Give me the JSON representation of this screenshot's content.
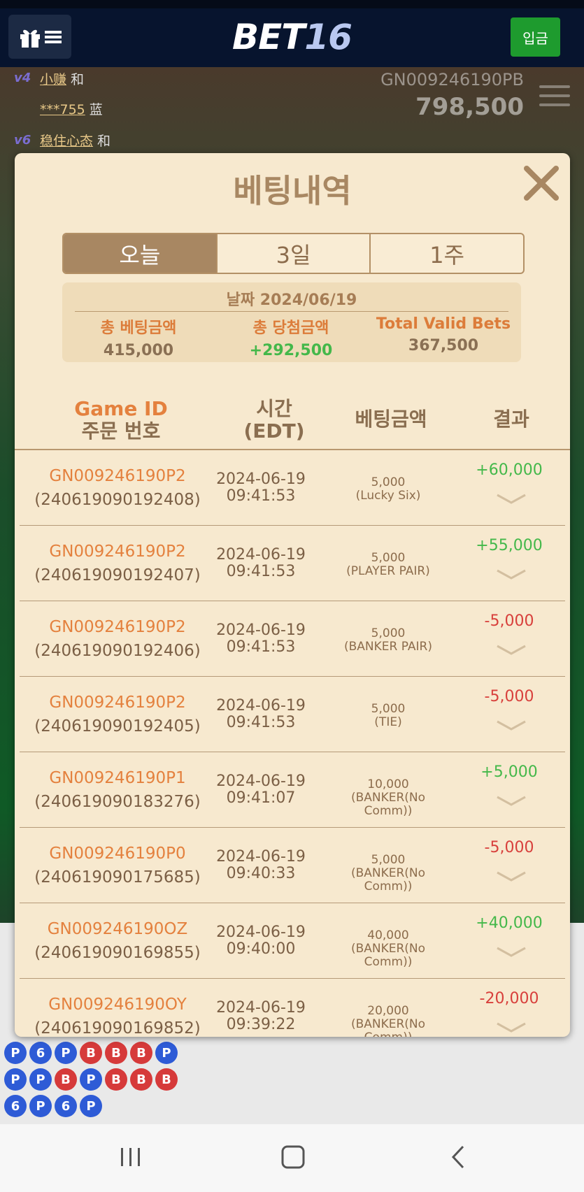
{
  "header": {
    "brand_main": "BET",
    "brand_num": "16",
    "deposit_label": "입금"
  },
  "background": {
    "chat": [
      {
        "level": "v4",
        "name": "小赚",
        "choice": "和"
      },
      {
        "level": "",
        "name": "***755",
        "choice": "蓝"
      },
      {
        "level": "v6",
        "name": "稳住心态",
        "choice": "和"
      }
    ],
    "game_id": "GN009246190PB",
    "balance": "798,500"
  },
  "modal": {
    "title": "베팅내역",
    "tabs": [
      "오늘",
      "3일",
      "1주"
    ],
    "active_tab": 0,
    "summary": {
      "date_label": "날짜 2024/06/19",
      "total_bet_label": "총 베팅금액",
      "total_bet_value": "415,000",
      "total_win_label": "총 당첨금액",
      "total_win_value": "+292,500",
      "valid_label": "Total Valid Bets",
      "valid_value": "367,500"
    },
    "columns": {
      "game_id": "Game ID",
      "order_no": "주문 번호",
      "time": "시간",
      "time_zone": "(EDT)",
      "amount": "베팅금액",
      "result": "결과"
    },
    "rows": [
      {
        "game_id": "GN009246190P2",
        "order": "(240619090192408)",
        "date": "2024-06-19",
        "time": "09:41:53",
        "amount": "5,000",
        "bet_type": "(Lucky Six)",
        "result": "+60,000",
        "status": "pos"
      },
      {
        "game_id": "GN009246190P2",
        "order": "(240619090192407)",
        "date": "2024-06-19",
        "time": "09:41:53",
        "amount": "5,000",
        "bet_type": "(PLAYER PAIR)",
        "result": "+55,000",
        "status": "pos"
      },
      {
        "game_id": "GN009246190P2",
        "order": "(240619090192406)",
        "date": "2024-06-19",
        "time": "09:41:53",
        "amount": "5,000",
        "bet_type": "(BANKER PAIR)",
        "result": "-5,000",
        "status": "neg"
      },
      {
        "game_id": "GN009246190P2",
        "order": "(240619090192405)",
        "date": "2024-06-19",
        "time": "09:41:53",
        "amount": "5,000",
        "bet_type": "(TIE)",
        "result": "-5,000",
        "status": "neg"
      },
      {
        "game_id": "GN009246190P1",
        "order": "(240619090183276)",
        "date": "2024-06-19",
        "time": "09:41:07",
        "amount": "10,000",
        "bet_type": "(BANKER(No Comm))",
        "result": "+5,000",
        "status": "pos"
      },
      {
        "game_id": "GN009246190P0",
        "order": "(240619090175685)",
        "date": "2024-06-19",
        "time": "09:40:33",
        "amount": "5,000",
        "bet_type": "(BANKER(No Comm))",
        "result": "-5,000",
        "status": "neg"
      },
      {
        "game_id": "GN009246190OZ",
        "order": "(240619090169855)",
        "date": "2024-06-19",
        "time": "09:40:00",
        "amount": "40,000",
        "bet_type": "(BANKER(No Comm))",
        "result": "+40,000",
        "status": "pos"
      },
      {
        "game_id": "GN009246190OY",
        "order": "(240619090169852)",
        "date": "2024-06-19",
        "time": "09:39:22",
        "amount": "20,000",
        "bet_type": "(BANKER(No Comm))",
        "result": "-20,000",
        "status": "neg"
      }
    ]
  },
  "roadmap": {
    "beads": [
      "P",
      "6",
      "P",
      "B",
      "B",
      "B",
      "P",
      "P",
      "P",
      "B",
      "P",
      "B",
      "B",
      "B",
      "6",
      "P",
      "6",
      "P"
    ]
  },
  "colors": {
    "accent": "#a88762",
    "positive": "#44b84a",
    "negative": "#d8403c",
    "highlight": "#e4813e"
  }
}
